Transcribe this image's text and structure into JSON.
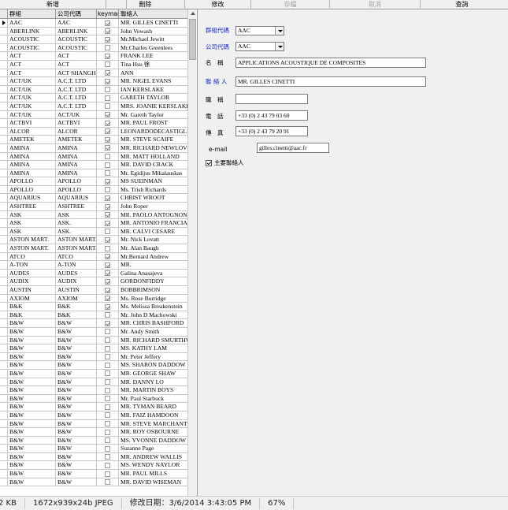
{
  "toolbar": {
    "buttons": [
      "新增",
      "刪除",
      "修改",
      "存檔",
      "取消",
      "查詢"
    ],
    "disabled": [
      false,
      false,
      false,
      true,
      true,
      false
    ]
  },
  "grid": {
    "headers": [
      "群組",
      "公司代碼",
      "keyman",
      "聯絡人"
    ],
    "rows": [
      {
        "group": "AAC",
        "company": "AAC",
        "keyman": true,
        "contact": "MR. GILLES CINETTI"
      },
      {
        "group": "ABERLINK",
        "company": "ABERLINK",
        "keyman": true,
        "contact": "John Vowash"
      },
      {
        "group": "ACOUSTIC",
        "company": "ACOUSTIC",
        "keyman": true,
        "contact": "Mr.Michael Jewitt"
      },
      {
        "group": "ACOUSTIC",
        "company": "ACOUSTIC",
        "keyman": false,
        "contact": "Mr.Charles Greenlees"
      },
      {
        "group": "ACT",
        "company": "ACT",
        "keyman": true,
        "contact": "FRANK LEE"
      },
      {
        "group": "ACT",
        "company": "ACT",
        "keyman": false,
        "contact": "Tina Hsu 徐"
      },
      {
        "group": "ACT",
        "company": "ACT SHANGH.",
        "keyman": true,
        "contact": "ANN"
      },
      {
        "group": "ACT/UK",
        "company": "A.C.T. LTD",
        "keyman": true,
        "contact": "MR. NIGEL EVANS"
      },
      {
        "group": "ACT/UK",
        "company": "A.C.T. LTD",
        "keyman": false,
        "contact": "IAN KERSLAKE"
      },
      {
        "group": "ACT/UK",
        "company": "A.C.T. LTD",
        "keyman": false,
        "contact": "GARETH TAYLOR"
      },
      {
        "group": "ACT/UK",
        "company": "A.C.T. LTD",
        "keyman": false,
        "contact": "MRS. JOANIE KERSLAKE"
      },
      {
        "group": "ACT/UK",
        "company": "ACT/UK",
        "keyman": true,
        "contact": "Mr. Gareth Taylor"
      },
      {
        "group": "ACTBVI",
        "company": "ACTBVI",
        "keyman": true,
        "contact": "MR. PAUL FROST"
      },
      {
        "group": "ALCOR",
        "company": "ALCOR",
        "keyman": true,
        "contact": "LEONARDODECASTIGLIONE"
      },
      {
        "group": "AMETEK",
        "company": "AMETEK",
        "keyman": true,
        "contact": "MR. STEVE SCAIFE"
      },
      {
        "group": "AMINA",
        "company": "AMINA",
        "keyman": true,
        "contact": "MR. RICHARD NEWLOVE"
      },
      {
        "group": "AMINA",
        "company": "AMINA",
        "keyman": false,
        "contact": "MR. MATT HOLLAND"
      },
      {
        "group": "AMINA",
        "company": "AMINA",
        "keyman": false,
        "contact": "MR. DAVID CRACK"
      },
      {
        "group": "AMINA",
        "company": "AMINA",
        "keyman": false,
        "contact": "Mr. Egidijus Mikalauskas"
      },
      {
        "group": "APOLLO",
        "company": "APOLLO",
        "keyman": true,
        "contact": "MS SUEINMAN"
      },
      {
        "group": "APOLLO",
        "company": "APOLLO",
        "keyman": false,
        "contact": "Ms. Trish Richards"
      },
      {
        "group": "AQUARIUS",
        "company": "AQUARIUS",
        "keyman": true,
        "contact": "CHRIST WROOT"
      },
      {
        "group": "ASHTREE",
        "company": "ASHTREE",
        "keyman": true,
        "contact": "John Roper"
      },
      {
        "group": "ASK",
        "company": "ASK",
        "keyman": true,
        "contact": "MR. PAOLO ANTOGNONI"
      },
      {
        "group": "ASK",
        "company": "ASK.",
        "keyman": true,
        "contact": "MR. ANTONIO FRANCIA"
      },
      {
        "group": "ASK",
        "company": "ASK.",
        "keyman": false,
        "contact": "MR. CALVI CESARE"
      },
      {
        "group": "ASTON MART.",
        "company": "ASTON MART.",
        "keyman": true,
        "contact": "Mr. Nick Lovatt"
      },
      {
        "group": "ASTON MART.",
        "company": "ASTON MART.",
        "keyman": false,
        "contact": "Mr. Alan Baugh"
      },
      {
        "group": "ATCO",
        "company": "ATCO",
        "keyman": true,
        "contact": "Mr.Bernard Andrew"
      },
      {
        "group": "A-TON",
        "company": "A-TON",
        "keyman": true,
        "contact": "MR."
      },
      {
        "group": "AUDES",
        "company": "AUDES",
        "keyman": true,
        "contact": "Galina Anasajeva"
      },
      {
        "group": "AUDIX",
        "company": "AUDIX",
        "keyman": true,
        "contact": "GORDONFIDDY"
      },
      {
        "group": "AUSTIN",
        "company": "AUSTIN",
        "keyman": true,
        "contact": "BOBBRIMSON"
      },
      {
        "group": "AXIOM",
        "company": "AXIOM",
        "keyman": true,
        "contact": "Ms. Rose Burridge"
      },
      {
        "group": "B&K",
        "company": "B&K",
        "keyman": true,
        "contact": "Ms. Melissa Breakenstein"
      },
      {
        "group": "B&K",
        "company": "B&K",
        "keyman": false,
        "contact": "Mr. John D Machowski"
      },
      {
        "group": "B&W",
        "company": "B&W",
        "keyman": true,
        "contact": "MR. CHRIS BASHFORD"
      },
      {
        "group": "B&W",
        "company": "B&W",
        "keyman": false,
        "contact": "Mr. Andy Smith"
      },
      {
        "group": "B&W",
        "company": "B&W",
        "keyman": false,
        "contact": "MR. RICHARD SMURTHWAITE"
      },
      {
        "group": "B&W",
        "company": "B&W",
        "keyman": false,
        "contact": "MS. KATHY LAM"
      },
      {
        "group": "B&W",
        "company": "B&W",
        "keyman": false,
        "contact": "Mr. Peter Jeffery"
      },
      {
        "group": "B&W",
        "company": "B&W",
        "keyman": false,
        "contact": "MS. SHARON DADDOW"
      },
      {
        "group": "B&W",
        "company": "B&W",
        "keyman": false,
        "contact": "MR. GEORGE SHAW"
      },
      {
        "group": "B&W",
        "company": "B&W",
        "keyman": false,
        "contact": "MR. DANNY LO"
      },
      {
        "group": "B&W",
        "company": "B&W",
        "keyman": false,
        "contact": "MR. MARTIN BOYS"
      },
      {
        "group": "B&W",
        "company": "B&W",
        "keyman": false,
        "contact": "Mr. Paul Starbuck"
      },
      {
        "group": "B&W",
        "company": "B&W",
        "keyman": false,
        "contact": "MR. TYMAN BEARD"
      },
      {
        "group": "B&W",
        "company": "B&W",
        "keyman": false,
        "contact": "MR. FAIZ HAMDOON"
      },
      {
        "group": "B&W",
        "company": "B&W",
        "keyman": false,
        "contact": "MR. STEVE MARCHANT"
      },
      {
        "group": "B&W",
        "company": "B&W",
        "keyman": false,
        "contact": "MR. ROY OSBOURNE"
      },
      {
        "group": "B&W",
        "company": "B&W",
        "keyman": false,
        "contact": "MS. YVONNE DADDOW"
      },
      {
        "group": "B&W",
        "company": "B&W",
        "keyman": false,
        "contact": "Suzanne Page"
      },
      {
        "group": "B&W",
        "company": "B&W",
        "keyman": false,
        "contact": "MR. ANDREW WALLIS"
      },
      {
        "group": "B&W",
        "company": "B&W",
        "keyman": false,
        "contact": "MS. WENDY NAYLOR"
      },
      {
        "group": "B&W",
        "company": "B&W",
        "keyman": false,
        "contact": "MR. PAUL MILLS"
      },
      {
        "group": "B&W",
        "company": "B&W",
        "keyman": false,
        "contact": "MR. DAVID WISEMAN"
      }
    ]
  },
  "detail": {
    "group_label": "群組代碼",
    "group_value": "AAC",
    "company_label": "公司代碼",
    "company_value": "AAC",
    "name_label": "名　稱",
    "name_value": "APPLICATIONS ACOUSTIQUE  DE COMPOSITES",
    "contact_label": "聯 絡 人",
    "contact_value": "MR. GILLES CINETTI",
    "title_label": "職　稱",
    "title_value": "",
    "phone_label": "電　話",
    "phone_value": "+33 (0) 2 43 79 03 60",
    "fax_label": "傳　真",
    "fax_value": "+33 (0) 2 43 79 20 91",
    "email_label": "e-mail",
    "email_value": "gilles.cinetti@aac.fr",
    "main_contact_label": "主要聯絡人",
    "main_contact_checked": true,
    "label_color": "#1a2ccc"
  },
  "statusbar": {
    "filesize": "2 KB",
    "image_info": "1672x939x24b JPEG",
    "modified": "修改日期：3/6/2014 3:43:05 PM",
    "zoom": "67%"
  }
}
